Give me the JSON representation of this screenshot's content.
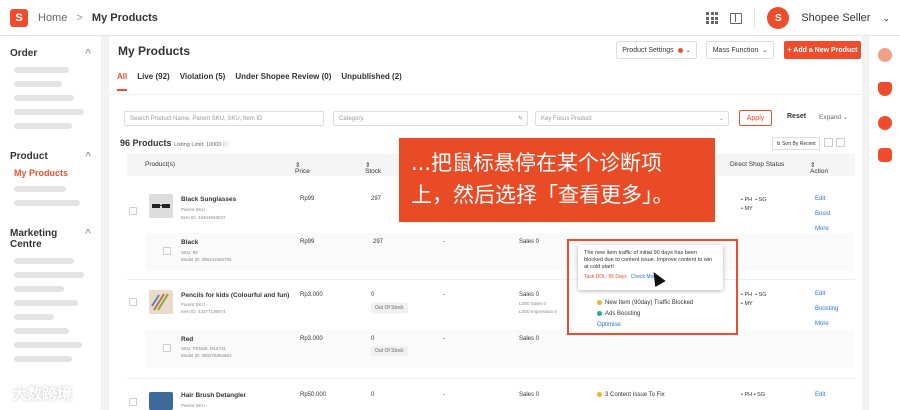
{
  "topbar": {
    "logo": "S",
    "breadcrumb_home": "Home",
    "breadcrumb_sep": ">",
    "breadcrumb_current": "My Products",
    "avatar": "S",
    "shop_name": "Shopee Seller",
    "dropdown_icon": "chevron-down-icon"
  },
  "sidebar": {
    "sections": [
      {
        "title": "Order",
        "collapse": "^"
      },
      {
        "title": "Product",
        "collapse": "^",
        "active_item": "My Products"
      },
      {
        "title": "Marketing Centre",
        "collapse": "^"
      }
    ]
  },
  "main": {
    "title": "My Products",
    "product_settings": "Product Settings",
    "mass_function": "Mass Function",
    "add_product": "+ Add a New Product",
    "tabs": [
      "All",
      "Live (92)",
      "Violation (5)",
      "Under Shopee Review (0)",
      "Unpublished (2)"
    ],
    "filters": {
      "search_placeholder": "Search Product Name, Parent SKU, SKU, Item ID",
      "category_placeholder": "Category",
      "focus_placeholder": "Key Focus Product",
      "apply": "Apply",
      "reset": "Reset",
      "expand": "Expand"
    },
    "count": "96 Products",
    "listing_limit": "Listing Limit: 10000",
    "sort": "Sort By Recent",
    "columns": {
      "product": "Product(s)",
      "price": "Price",
      "stock": "Stock",
      "direct_shop": "Direct Shop Status",
      "action": "Action"
    },
    "rows": [
      {
        "name": "Black Sunglasses",
        "parent_sku": "Parent SKU -",
        "item_id": "Item ID: 49404658047",
        "price": "Rp99",
        "stock": "297",
        "status": "• PH  • SG\n• MY",
        "actions": [
          "Edit",
          "Boost",
          "More"
        ],
        "variant": {
          "name": "Black",
          "sku": "SKU: 99",
          "model_id": "Model ID: 395431065785",
          "price": "Rp99",
          "stock": "297",
          "dash": "-",
          "sales": "Sales 0"
        }
      },
      {
        "name": "Pencils for kids (Colourful and fun)",
        "parent_sku": "Parent SKU -",
        "item_id": "Item ID: 43377136874",
        "price": "Rp3.000",
        "stock": "0",
        "oos": "Out Of Stock",
        "dash": "-",
        "sales": "Sales 0",
        "l30d_sales": "L30D Sales 0",
        "l30d_impr": "L30D Impression 4",
        "diag_1": "New Item (90day) Traffic Blocked",
        "diag_2": "Ads Boosting",
        "optimise": "Optimise",
        "status": "• PH  • SG\n• MY",
        "actions": [
          "Edit",
          "Boosting",
          "More"
        ],
        "variant": {
          "name": "Red",
          "sku": "SKU: PENSIL MULTI4",
          "model_id": "Model ID: 380276394663",
          "price": "Rp3.000",
          "stock": "0",
          "oos": "Out Of Stock",
          "dash": "-",
          "sales": "Sales 0"
        }
      },
      {
        "name": "Hair Brush Detangler",
        "parent_sku": "Parent SKU -",
        "price": "Rp50.000",
        "stock": "0",
        "dash": "-",
        "sales": "Sales 0",
        "diag": "3 Content Issue To Fix",
        "status": "• PH  • SG",
        "action": "Edit"
      }
    ],
    "tooltip": {
      "text": "The new item traffic of initial 90 days has been blocked due to content issue. Improve content to win at cold start!",
      "task": "Task DDL: 55 Days",
      "more": "Check More"
    }
  },
  "callout": {
    "line1": "...把鼠标悬停在某个诊断项",
    "line2": "上，然后选择「查看更多」。"
  },
  "watermark": "大数跨境",
  "colors": {
    "brand": "#ee4d2d",
    "link": "#2673dd",
    "callout": "#e84b25"
  }
}
